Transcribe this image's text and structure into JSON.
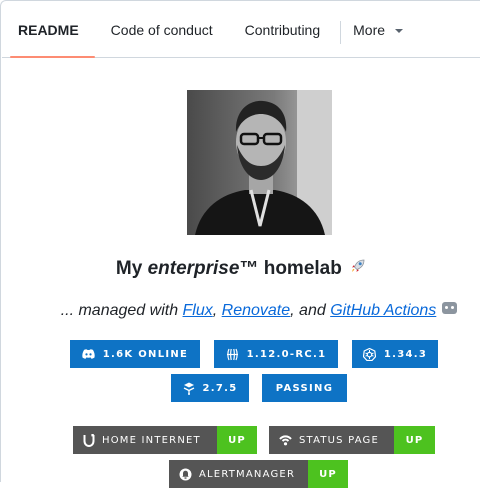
{
  "tabs": [
    {
      "label": "README",
      "active": true
    },
    {
      "label": "Code of conduct",
      "active": false
    },
    {
      "label": "Contributing",
      "active": false
    }
  ],
  "more_label": "More",
  "title": {
    "prefix": "My ",
    "emphasis": "enterprise",
    "suffix": "™ homelab"
  },
  "tagline": {
    "prefix": "... managed with ",
    "link1": "Flux",
    "sep1": ", ",
    "link2": "Renovate",
    "sep2": ", and ",
    "link3": "GitHub Actions"
  },
  "badges": [
    {
      "icon": "discord-icon",
      "text": "1.6K ONLINE"
    },
    {
      "icon": "talos-icon",
      "text": "1.12.0-RC.1"
    },
    {
      "icon": "kubernetes-icon",
      "text": "1.34.3"
    },
    {
      "icon": "flux-icon",
      "text": "2.7.5"
    },
    {
      "icon": "",
      "text": "PASSING"
    }
  ],
  "status_badges": [
    {
      "icon": "ubiquiti-icon",
      "label": "HOME INTERNET",
      "value": "UP"
    },
    {
      "icon": "status-page-icon",
      "label": "STATUS PAGE",
      "value": "UP"
    },
    {
      "icon": "alertmanager-icon",
      "label": "ALERTMANAGER",
      "value": "UP"
    }
  ],
  "colors": {
    "badge_blue": "#0e73c5",
    "status_grey": "#555555",
    "status_green": "#4dc21f",
    "link": "#0969da",
    "tab_underline": "#fd8c73"
  }
}
